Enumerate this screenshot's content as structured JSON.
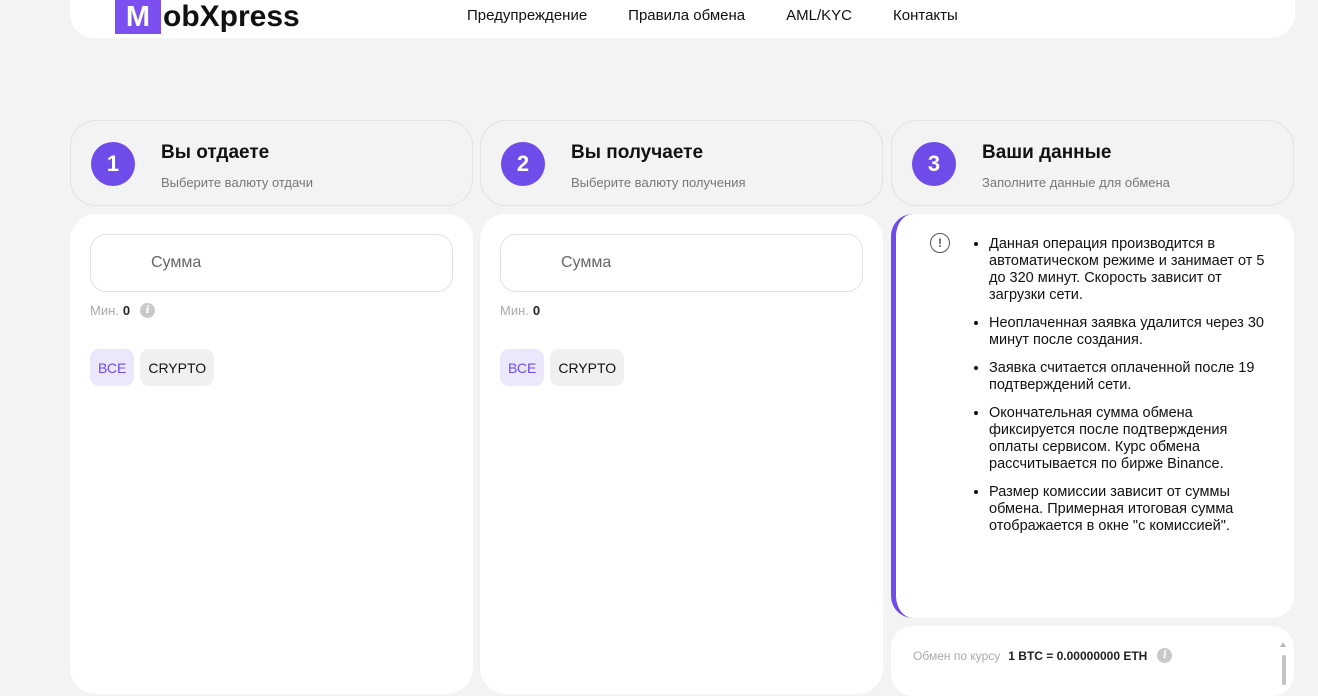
{
  "header": {
    "logo_letter": "M",
    "logo_rest": "obXpress",
    "nav": [
      "Предупреждение",
      "Правила обмена",
      "AML/KYC",
      "Контакты"
    ]
  },
  "steps": [
    {
      "num": "1",
      "title": "Вы отдаете",
      "subtitle": "Выберите валюту отдачи"
    },
    {
      "num": "2",
      "title": "Вы получаете",
      "subtitle": "Выберите валюту получения"
    },
    {
      "num": "3",
      "title": "Ваши данные",
      "subtitle": "Заполните данные для обмена"
    }
  ],
  "give": {
    "amount_placeholder": "Сумма",
    "min_label": "Мин.",
    "min_value": "0",
    "info_icon": "info-icon",
    "filters": [
      "ВСЕ",
      "CRYPTO"
    ]
  },
  "receive": {
    "amount_placeholder": "Сумма",
    "min_label": "Мин.",
    "min_value": "0",
    "filters": [
      "ВСЕ",
      "CRYPTO"
    ]
  },
  "notice": {
    "icon": "exclamation-circle-icon",
    "items": [
      "Данная операция производится в автоматическом режиме и занимает от 5 до 320 минут. Скорость зависит от загрузки сети.",
      "Неоплаченная заявка удалится через 30 минут после создания.",
      "Заявка считается оплаченной после 19 подтверждений сети.",
      "Окончательная сумма обмена фиксируется после подтверждения оплаты сервисом. Курс обмена рассчитывается по бирже Binance.",
      "Размер комиссии зависит от суммы обмена. Примерная итоговая сумма отображается в окне \"с комиссией\"."
    ]
  },
  "rate": {
    "label": "Обмен по курсу",
    "value": "1 BTC = 0.00000000 ETH"
  },
  "colors": {
    "accent": "#6f4bea",
    "background": "#f3f3f3"
  }
}
